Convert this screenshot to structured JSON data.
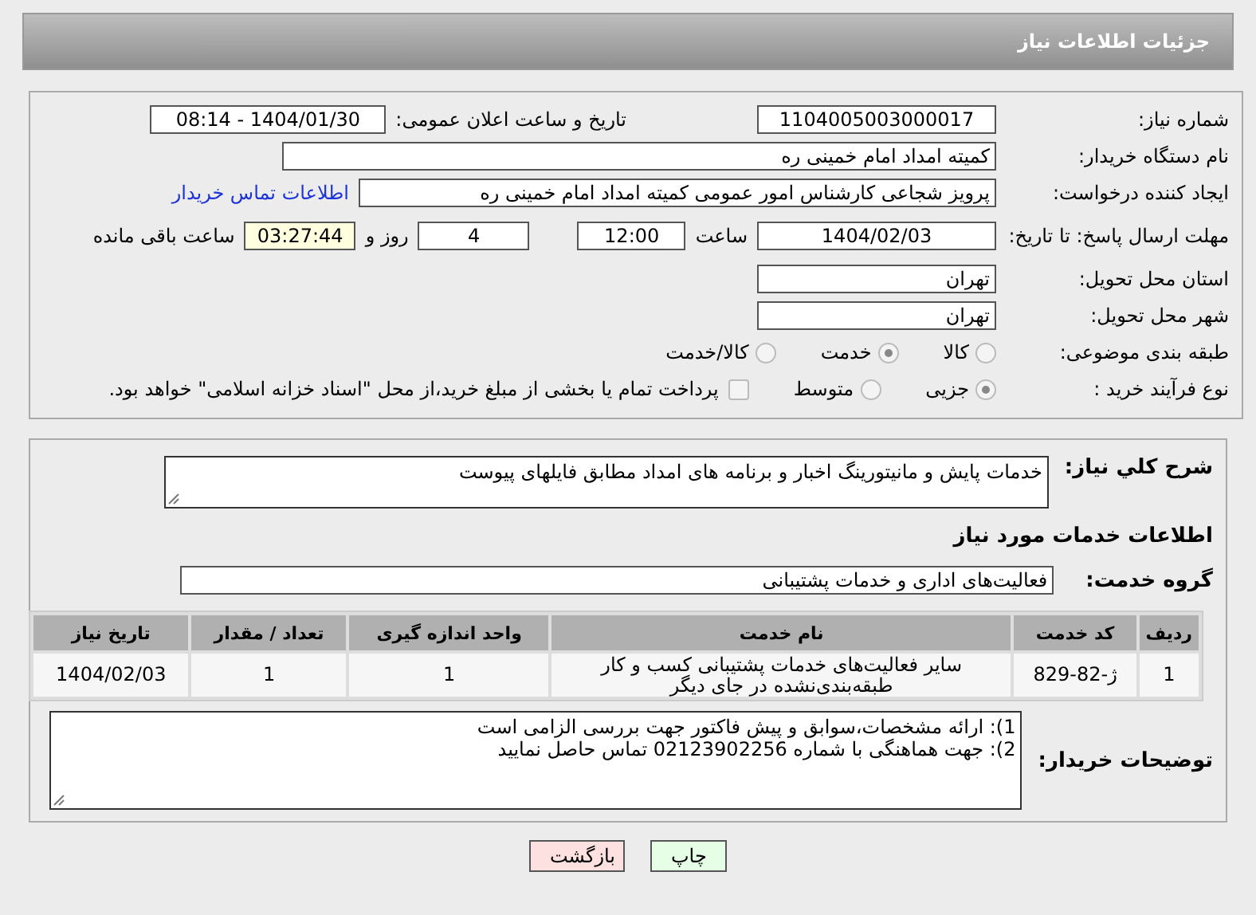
{
  "header": {
    "title": "جزئیات اطلاعات نیاز"
  },
  "details": {
    "need_number": {
      "label": "شماره نیاز:",
      "value": "1104005003000017"
    },
    "announce_date": {
      "label": "تاریخ و ساعت اعلان عمومی:",
      "value": "1404/01/30 - 08:14"
    },
    "buyer_org": {
      "label": "نام دستگاه خریدار:",
      "value": "کمیته امداد امام خمینی ره"
    },
    "requester": {
      "label": "ایجاد کننده درخواست:",
      "value": "پرویز شجاعی کارشناس امور عمومی کمیته امداد امام خمینی ره",
      "link": "اطلاعات تماس خریدار"
    },
    "deadline": {
      "label": "مهلت ارسال پاسخ: تا تاریخ:",
      "date": "1404/02/03",
      "time_label": "ساعت",
      "time": "12:00",
      "days": "4",
      "days_label": "روز و",
      "remaining": "03:27:44",
      "remaining_label": "ساعت باقی مانده"
    },
    "province": {
      "label": "استان محل تحویل:",
      "value": "تهران"
    },
    "city": {
      "label": "شهر محل تحویل:",
      "value": "تهران"
    },
    "category": {
      "label": "طبقه بندی موضوعی:",
      "options": [
        {
          "label": "کالا",
          "selected": false
        },
        {
          "label": "خدمت",
          "selected": true
        },
        {
          "label": "کالا/خدمت",
          "selected": false
        }
      ]
    },
    "process": {
      "label": "نوع فرآیند خرید :",
      "options": [
        {
          "label": "جزیی",
          "selected": true
        },
        {
          "label": "متوسط",
          "selected": false
        }
      ],
      "payment": {
        "label": "پرداخت تمام یا بخشی از مبلغ خرید،از محل \"اسناد خزانه اسلامی\" خواهد بود.",
        "checked": false
      }
    }
  },
  "services": {
    "summary": {
      "label": "شرح کلي نیاز:",
      "value": "خدمات پایش و مانیتورینگ اخبار و برنامه های امداد مطابق فایلهای پیوست"
    },
    "section_title": "اطلاعات خدمات مورد نیاز",
    "group": {
      "label": "گروه خدمت:",
      "value": "فعالیت‌های اداری و خدمات پشتیبانی"
    },
    "table": {
      "columns": [
        "ردیف",
        "کد خدمت",
        "نام خدمت",
        "واحد اندازه گیری",
        "تعداد / مقدار",
        "تاریخ نیاز"
      ],
      "rows": [
        [
          "1",
          "ژ-82-829",
          "سایر فعالیت‌های خدمات پشتیبانی کسب و کار طبقه‌بندی‌نشده در جای دیگر",
          "1",
          "1",
          "1404/02/03"
        ]
      ]
    },
    "notes": {
      "label": "توضیحات خریدار:",
      "lines": [
        "1): ارائه مشخصات،سوابق و پیش فاکتور جهت بررسی الزامی است",
        "2): جهت هماهنگی با شماره 02123902256 تماس حاصل نمایید"
      ]
    }
  },
  "buttons": [
    {
      "label": "چاپ",
      "kind": "print"
    },
    {
      "label": "بازگشت",
      "kind": "back"
    }
  ]
}
